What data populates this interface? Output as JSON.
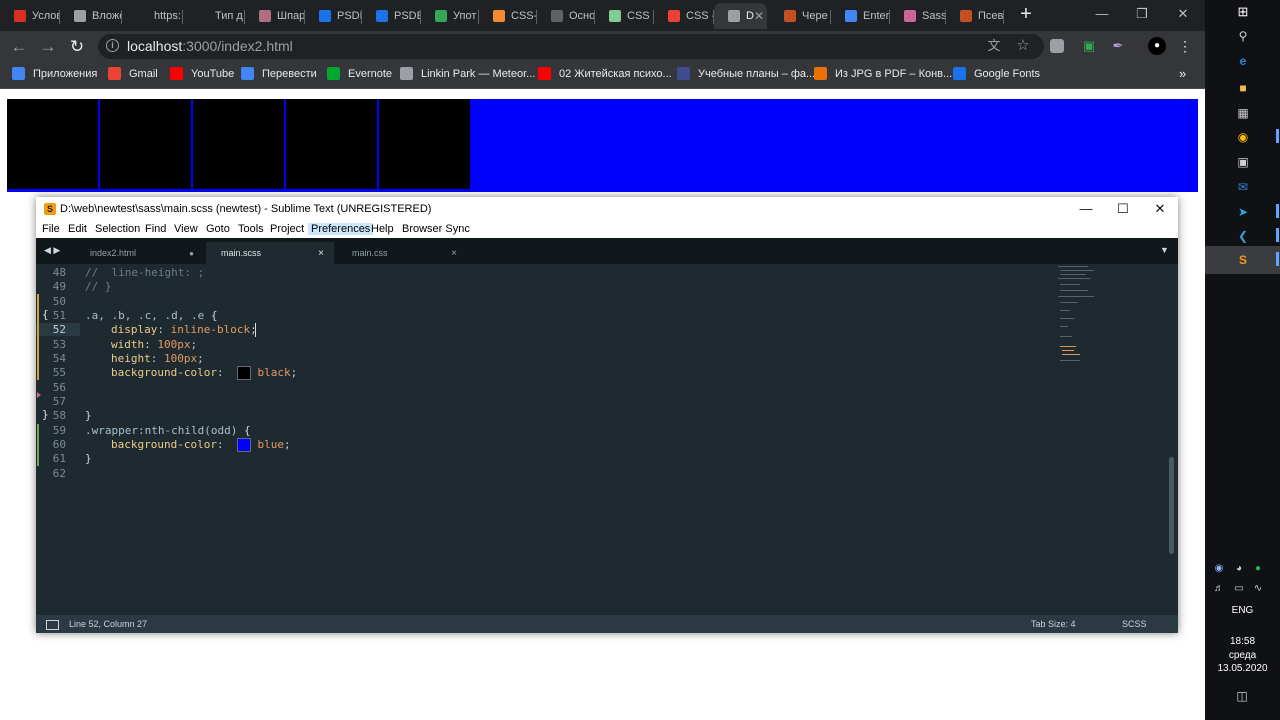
{
  "browser": {
    "tabs": [
      {
        "label": "Услов",
        "icon": "yandex-icon",
        "color": "#d93025"
      },
      {
        "label": "Вложе",
        "icon": "comment-icon",
        "color": "#9aa0a6"
      },
      {
        "label": "https:",
        "icon": "angular-icon",
        "color": "#202124"
      },
      {
        "label": "Тип д",
        "icon": "chain-icon",
        "color": "#202124"
      },
      {
        "label": "Шпар",
        "icon": "book-icon",
        "color": "#b06f7f"
      },
      {
        "label": "PSDE",
        "icon": "photoshop-icon",
        "color": "#1a73e8"
      },
      {
        "label": "PSDE",
        "icon": "photoshop-icon",
        "color": "#1a73e8"
      },
      {
        "label": "Упот",
        "icon": "leaf-icon",
        "color": "#34a853"
      },
      {
        "label": "CSS-",
        "icon": "dots-icon",
        "color": "#f28b30"
      },
      {
        "label": "Осно",
        "icon": "slide-icon",
        "color": "#5f6368"
      },
      {
        "label": "CSS -",
        "icon": "globe-icon",
        "color": "#81c995"
      },
      {
        "label": "CSS -",
        "icon": "record-icon",
        "color": "#ea4335"
      },
      {
        "label": "D",
        "icon": "globe-icon",
        "color": "#9aa0a6",
        "active": true
      },
      {
        "label": "Чере",
        "icon": "brick-icon",
        "color": "#c5501f"
      },
      {
        "label": "Enter",
        "icon": "ns-icon",
        "color": "#4285f4"
      },
      {
        "label": "Sass:",
        "icon": "sass-icon",
        "color": "#cc6699"
      },
      {
        "label": "Псев",
        "icon": "brick-icon",
        "color": "#c5501f"
      }
    ],
    "url_host": "localhost",
    "url_path": ":3000/index2.html",
    "bookmarks": [
      {
        "label": "Приложения",
        "icon": "apps-icon",
        "color": "#4285f4"
      },
      {
        "label": "Gmail",
        "icon": "gmail-icon",
        "color": "#ea4335"
      },
      {
        "label": "YouTube",
        "icon": "youtube-icon",
        "color": "#ff0000"
      },
      {
        "label": "Перевести",
        "icon": "translate-icon",
        "color": "#4285f4"
      },
      {
        "label": "Evernote",
        "icon": "evernote-icon",
        "color": "#00a82d"
      },
      {
        "label": "Linkin Park — Meteor...",
        "icon": "slash-icon",
        "color": "#9aa0a6"
      },
      {
        "label": "02 Житейская психо...",
        "icon": "youtube-icon",
        "color": "#ff0000"
      },
      {
        "label": "Учебные планы – фа...",
        "icon": "shield-icon",
        "color": "#3c4c8c"
      },
      {
        "label": "Из JPG в PDF – Конв...",
        "icon": "pdf-icon",
        "color": "#e8710a"
      },
      {
        "label": "Google Fonts",
        "icon": "fonts-icon",
        "color": "#1a73e8"
      }
    ],
    "more_bookmarks": "»"
  },
  "page": {
    "wrapper_color": "#0000ff",
    "box_color": "#000000",
    "box_count": 5
  },
  "sublime": {
    "title": "D:\\web\\newtest\\sass\\main.scss (newtest) - Sublime Text (UNREGISTERED)",
    "menu": [
      "File",
      "Edit",
      "Selection",
      "Find",
      "View",
      "Goto",
      "Tools",
      "Project",
      "Preferences",
      "Help",
      "Browser Sync"
    ],
    "tabs": [
      {
        "label": "index2.html",
        "marker": "●"
      },
      {
        "label": "main.scss",
        "marker": "×",
        "active": true
      },
      {
        "label": "main.css",
        "marker": "×"
      }
    ],
    "line_numbers": [
      "48",
      "49",
      "50",
      "51",
      "52",
      "53",
      "54",
      "55",
      "56",
      "57",
      "58",
      "59",
      "60",
      "61",
      "62"
    ],
    "code": {
      "l48": "//  line-height: ;",
      "l49": "// }",
      "l51_sel": ".a, .b, .c, .d, .e",
      "l51_brace": " {",
      "l52_prop": "display",
      "l52_val": "inline-block",
      "l53_prop": "width",
      "l53_val": "100px",
      "l54_prop": "height",
      "l54_val": "100px",
      "l55_prop": "background-color",
      "l55_val": "black",
      "l58": "}",
      "l59_sel": ".wrapper:nth-child(odd)",
      "l59_brace": " {",
      "l60_prop": "background-color",
      "l60_val": "blue",
      "l61": "}",
      "colon": ":",
      "semicolon": ";"
    },
    "status": {
      "position": "Line 52, Column 27",
      "tab_size": "Tab Size: 4",
      "syntax": "SCSS"
    }
  },
  "taskbar": {
    "language": "ENG",
    "time": "18:58",
    "day": "среда",
    "date": "13.05.2020"
  }
}
